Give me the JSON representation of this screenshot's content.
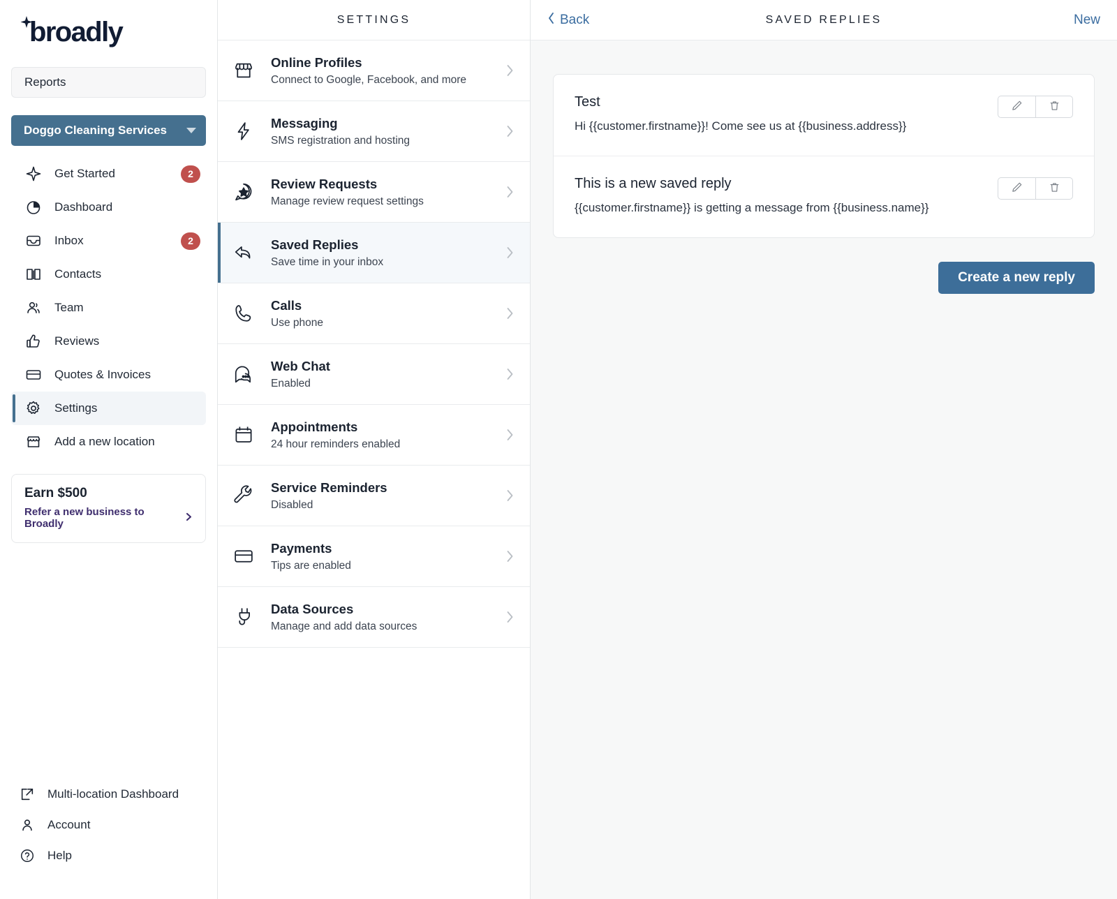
{
  "brand": {
    "logo_text": "broadly",
    "logo_icon": "sparkle-icon"
  },
  "sidebar": {
    "reports_label": "Reports",
    "location": {
      "name": "Doggo Cleaning Services",
      "caret_icon": "chevron-down-icon"
    },
    "items": [
      {
        "label": "Get Started",
        "icon": "sparkle-icon",
        "badge": "2"
      },
      {
        "label": "Dashboard",
        "icon": "pie-chart-icon",
        "badge": ""
      },
      {
        "label": "Inbox",
        "icon": "inbox-icon",
        "badge": "2"
      },
      {
        "label": "Contacts",
        "icon": "book-icon",
        "badge": ""
      },
      {
        "label": "Team",
        "icon": "people-icon",
        "badge": ""
      },
      {
        "label": "Reviews",
        "icon": "thumbs-up-icon",
        "badge": ""
      },
      {
        "label": "Quotes & Invoices",
        "icon": "card-icon",
        "badge": ""
      },
      {
        "label": "Settings",
        "icon": "gear-icon",
        "badge": ""
      },
      {
        "label": "Add a new location",
        "icon": "storefront-icon",
        "badge": ""
      }
    ],
    "referral": {
      "title": "Earn $500",
      "link": "Refer a new business to Broadly",
      "arrow_icon": "chevron-right-icon"
    },
    "footer_items": [
      {
        "label": "Multi-location Dashboard",
        "icon": "external-link-icon"
      },
      {
        "label": "Account",
        "icon": "person-icon"
      },
      {
        "label": "Help",
        "icon": "question-circle-icon"
      }
    ]
  },
  "settings": {
    "header": "SETTINGS",
    "items": [
      {
        "title": "Online Profiles",
        "subtitle": "Connect to Google, Facebook, and more",
        "icon": "storefront-icon"
      },
      {
        "title": "Messaging",
        "subtitle": "SMS registration and hosting",
        "icon": "bolt-icon"
      },
      {
        "title": "Review Requests",
        "subtitle": "Manage review request settings",
        "icon": "star-chat-icon"
      },
      {
        "title": "Saved Replies",
        "subtitle": "Save time in your inbox",
        "icon": "reply-arrow-icon"
      },
      {
        "title": "Calls",
        "subtitle": "Use phone",
        "icon": "phone-icon"
      },
      {
        "title": "Web Chat",
        "subtitle": "Enabled",
        "icon": "chat-bubble-icon"
      },
      {
        "title": "Appointments",
        "subtitle": "24 hour reminders enabled",
        "icon": "calendar-icon"
      },
      {
        "title": "Service Reminders",
        "subtitle": "Disabled",
        "icon": "wrench-icon"
      },
      {
        "title": "Payments",
        "subtitle": "Tips are enabled",
        "icon": "credit-card-icon"
      },
      {
        "title": "Data Sources",
        "subtitle": "Manage and add data sources",
        "icon": "plug-icon"
      }
    ]
  },
  "main": {
    "back_label": "Back",
    "title": "SAVED REPLIES",
    "new_label": "New",
    "replies": [
      {
        "title": "Test",
        "body": "Hi {{customer.firstname}}! Come see us at {{business.address}}"
      },
      {
        "title": "This is a new saved reply",
        "body": "{{customer.firstname}} is getting a message from {{business.name}}"
      }
    ],
    "create_button": "Create a new reply",
    "edit_icon": "pencil-icon",
    "delete_icon": "trash-icon"
  },
  "colors": {
    "accent_blue": "#45708f",
    "button_blue": "#3d6e99",
    "badge_red": "#c0504d",
    "link_blue": "#3b6da0",
    "referral_purple": "#3f2e6e"
  }
}
